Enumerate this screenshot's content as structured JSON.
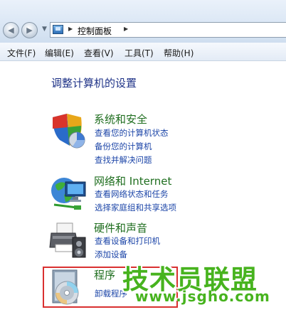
{
  "addressbar": {
    "crumb": "控制面板"
  },
  "menubar": {
    "items": [
      "文件(F)",
      "编辑(E)",
      "查看(V)",
      "工具(T)",
      "帮助(H)"
    ]
  },
  "main": {
    "title": "调整计算机的设置",
    "categories": [
      {
        "title": "系统和安全",
        "icon": "shield-icon",
        "links": [
          "查看您的计算机状态",
          "备份您的计算机",
          "查找并解决问题"
        ]
      },
      {
        "title": "网络和 Internet",
        "icon": "network-globe-icon",
        "links": [
          "查看网络状态和任务",
          "选择家庭组和共享选项"
        ]
      },
      {
        "title": "硬件和声音",
        "icon": "printer-icon",
        "links": [
          "查看设备和打印机",
          "添加设备"
        ]
      },
      {
        "title": "程序",
        "icon": "programs-disc-icon",
        "links": [
          "卸载程序"
        ]
      }
    ]
  },
  "watermark": {
    "main": "技术员联盟",
    "url": "www.jsgho.com"
  },
  "colors": {
    "category_title": "#1f6e1f",
    "link": "#1d46a8",
    "page_title": "#1e3287",
    "highlight": "#d93030",
    "watermark": "#47b31e"
  }
}
